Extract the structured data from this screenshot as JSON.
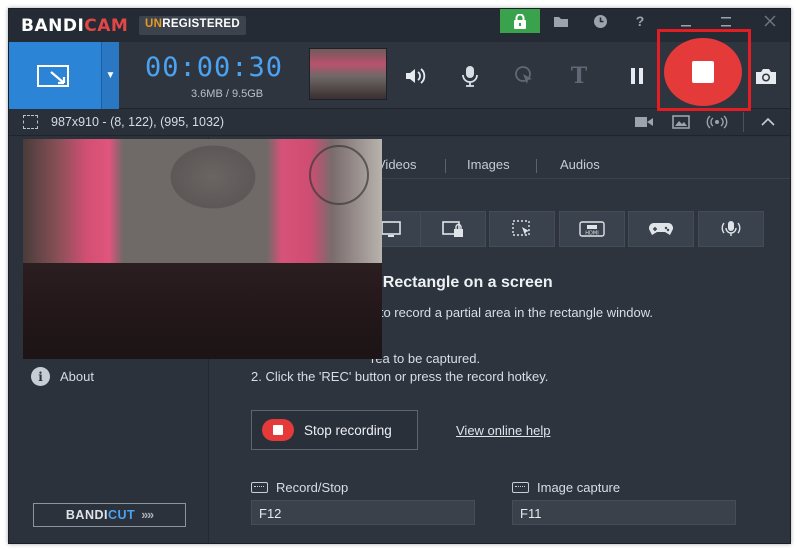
{
  "app": {
    "logo_main": "BANDI",
    "logo_accent": "CAM",
    "status_accent": "UN",
    "status_rest": "REGISTERED"
  },
  "toolbar": {
    "timer": "00:00:30",
    "file_size": "3.6MB / 9.5GB",
    "text_tool": "T"
  },
  "infobar": {
    "coords": "987x910 - (8, 122), (995, 1032)"
  },
  "tabs": [
    {
      "label": "Videos"
    },
    {
      "label": "Images"
    },
    {
      "label": "Audios"
    }
  ],
  "sidebar": {
    "about_label": "About",
    "bandicut_main": "BANDI",
    "bandicut_accent": "CUT",
    "bandicut_arrows": "»»"
  },
  "content": {
    "heading": "ng - Rectangle on a screen",
    "description": "u to record a partial area in the rectangle window.",
    "step1": "rea to be captured.",
    "step2": "2. Click the 'REC' button or press the record hotkey.",
    "stop_label": "Stop recording",
    "help_link": "View online help"
  },
  "hotkeys": {
    "record_label": "Record/Stop",
    "record_value": "F12",
    "capture_label": "Image capture",
    "capture_value": "F11"
  },
  "colors": {
    "accent_blue": "#2c84d6",
    "record_red": "#e43a3a",
    "highlight_red": "#e21d24",
    "lock_green": "#3aa14d",
    "unregistered_orange": "#e69a26"
  }
}
